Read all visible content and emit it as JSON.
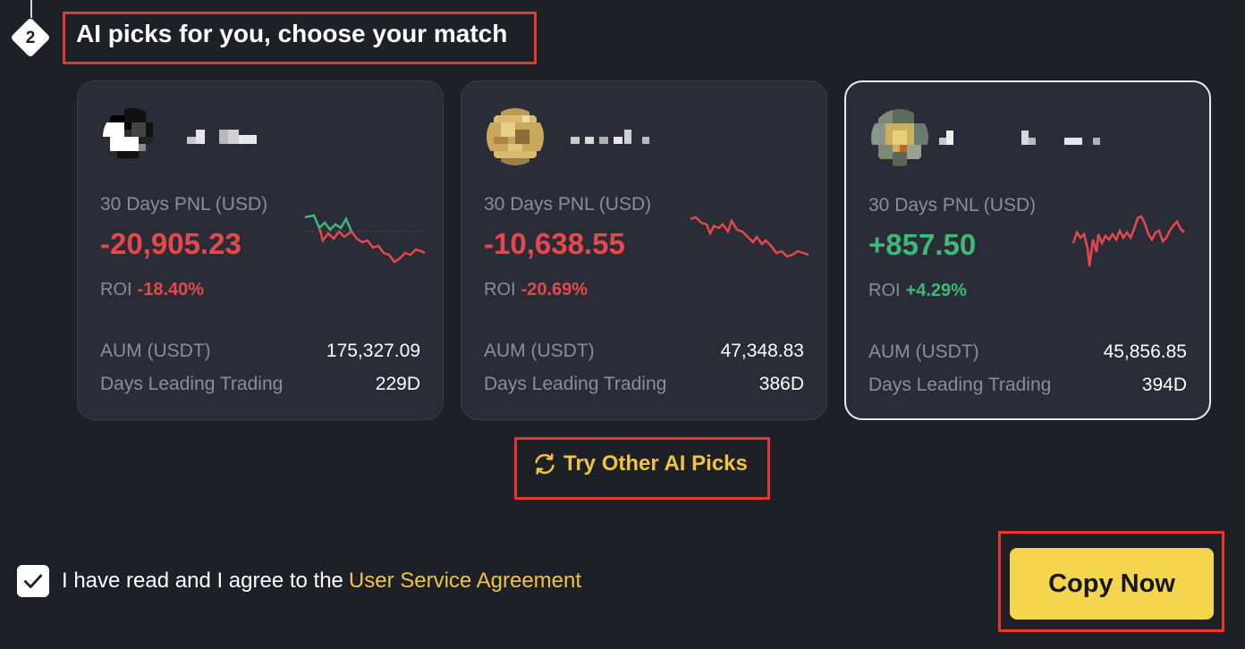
{
  "step": {
    "number": "2",
    "title": "AI picks for you, choose your match"
  },
  "colors": {
    "negative": "#e5484d",
    "positive": "#3fb97a",
    "accent": "#f0c341",
    "button": "#f5d54e"
  },
  "cards": [
    {
      "pnl_label": "30 Days PNL (USD)",
      "pnl": "-20,905.23",
      "roi_label": "ROI",
      "roi": "-18.40%",
      "aum_label": "AUM (USDT)",
      "aum": "175,327.09",
      "days_label": "Days Leading Trading",
      "days": "229D",
      "trend": "negative",
      "selected": false
    },
    {
      "pnl_label": "30 Days PNL (USD)",
      "pnl": "-10,638.55",
      "roi_label": "ROI",
      "roi": "-20.69%",
      "aum_label": "AUM (USDT)",
      "aum": "47,348.83",
      "days_label": "Days Leading Trading",
      "days": "386D",
      "trend": "negative",
      "selected": false
    },
    {
      "pnl_label": "30 Days PNL (USD)",
      "pnl": "+857.50",
      "roi_label": "ROI",
      "roi": "+4.29%",
      "aum_label": "AUM (USDT)",
      "aum": "45,856.85",
      "days_label": "Days Leading Trading",
      "days": "394D",
      "trend": "positive",
      "selected": true
    }
  ],
  "try_other": {
    "label": "Try Other AI Picks",
    "icon": "refresh-icon"
  },
  "agreement": {
    "checked": true,
    "text": "I have read and I agree to the",
    "link": "User Service Agreement"
  },
  "copy_button": {
    "label": "Copy Now"
  }
}
